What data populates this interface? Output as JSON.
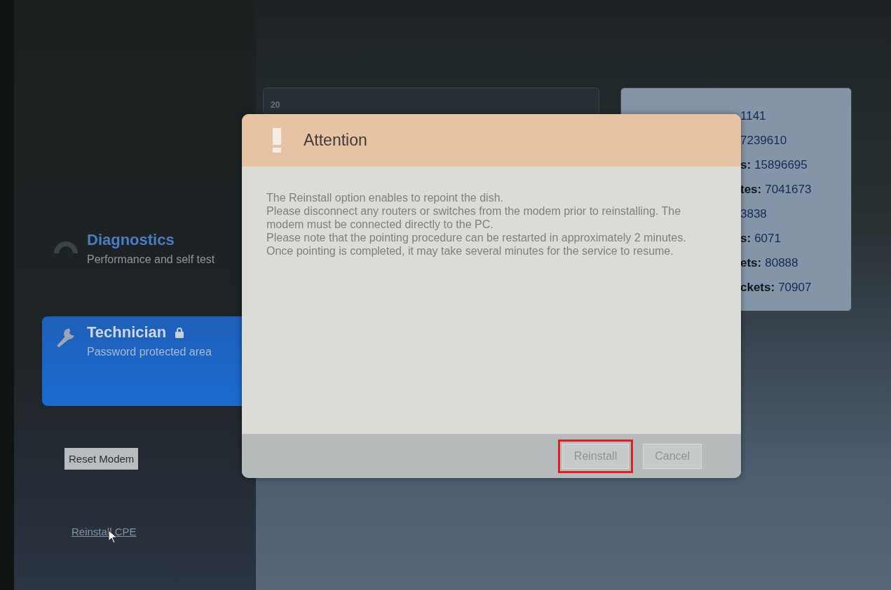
{
  "sidebar": {
    "items": [
      {
        "title": "Diagnostics",
        "subtitle": "Performance and self test",
        "locked": false,
        "selected": false
      },
      {
        "title": "Technician",
        "subtitle": "Password protected area",
        "locked": true,
        "selected": true
      }
    ],
    "reset_button": "Reset Modem",
    "reinstall_link": "Reinstall CPE"
  },
  "chart_card": {
    "axis_value": "20"
  },
  "stats": [
    {
      "value": "1141"
    },
    {
      "value": "7239610"
    },
    {
      "label": "s:",
      "value": "15896695"
    },
    {
      "label": "tes:",
      "value": "7041673"
    },
    {
      "value": "3838"
    },
    {
      "label": "s:",
      "value": "6071"
    },
    {
      "label": "ets:",
      "value": "80888"
    },
    {
      "label": "ckets:",
      "value": "70907"
    }
  ],
  "dialog": {
    "title": "Attention",
    "lines": [
      "The Reinstall option enables to repoint the dish.",
      "Please disconnect any routers or switches from the modem prior to reinstalling. The modem must be connected directly to the PC.",
      "Please note that the pointing procedure can be restarted in approximately 2 minutes.",
      "Once pointing is completed, it may take several minutes for the service to resume."
    ],
    "buttons": [
      {
        "label": "Reinstall",
        "highlighted": true
      },
      {
        "label": "Cancel",
        "highlighted": false
      }
    ]
  }
}
